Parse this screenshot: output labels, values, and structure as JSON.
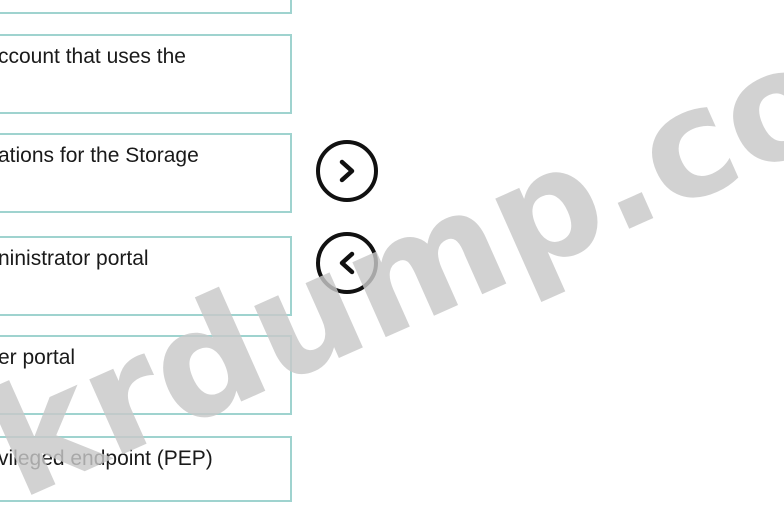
{
  "items": [
    {
      "label": ""
    },
    {
      "label": "ccount that uses the"
    },
    {
      "label": "ations for the Storage"
    },
    {
      "label": "ninistrator portal"
    },
    {
      "label": "er portal"
    },
    {
      "label": "vileged endpoint (PEP)"
    }
  ],
  "controls": {
    "move_right_icon": "chevron-right-icon",
    "move_left_icon": "chevron-left-icon"
  },
  "watermark": {
    "text": "krdump.com",
    "color": "#c8c8c8"
  }
}
